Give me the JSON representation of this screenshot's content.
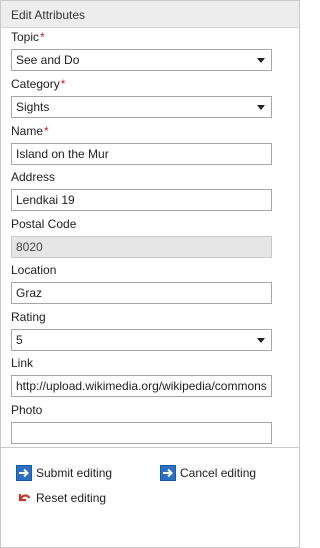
{
  "header": {
    "title": "Edit Attributes"
  },
  "required_marker": "*",
  "fields": {
    "topic": {
      "label": "Topic",
      "value": "See and Do"
    },
    "category": {
      "label": "Category",
      "value": "Sights"
    },
    "name": {
      "label": "Name",
      "value": "Island on the Mur"
    },
    "address": {
      "label": "Address",
      "value": "Lendkai 19"
    },
    "postal_code": {
      "label": "Postal Code",
      "value": "8020"
    },
    "location": {
      "label": "Location",
      "value": "Graz"
    },
    "rating": {
      "label": "Rating",
      "value": "5"
    },
    "link": {
      "label": "Link",
      "value": "http://upload.wikimedia.org/wikipedia/commons"
    },
    "photo": {
      "label": "Photo",
      "value": ""
    }
  },
  "actions": {
    "submit": "Submit editing",
    "cancel": "Cancel editing",
    "reset": "Reset editing"
  },
  "icons": {
    "submit": "arrow-right-icon",
    "cancel": "arrow-right-icon",
    "reset": "undo-icon"
  },
  "colors": {
    "action_icon_blue": "#2a6fc4",
    "reset_icon_red": "#c0392b",
    "required_red": "#cc2222"
  }
}
